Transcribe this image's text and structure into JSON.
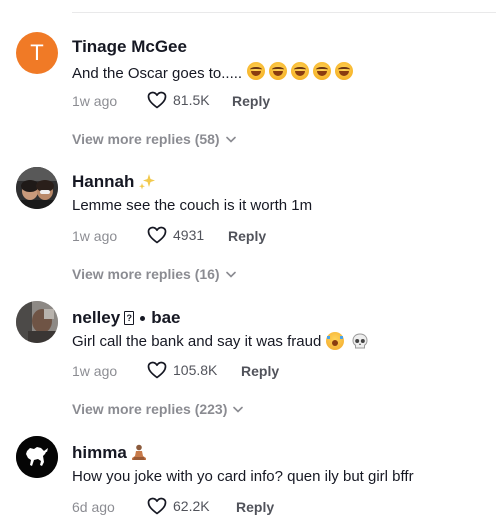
{
  "comments": [
    {
      "username": "Tinage McGee",
      "avatar_letter": "T",
      "text": "And the Oscar goes to.....",
      "time": "1w ago",
      "likes": "81.5K",
      "reply_label": "Reply",
      "more_replies": "View more replies (58)"
    },
    {
      "username": "Hannah",
      "text": "Lemme see the couch is it worth 1m",
      "time": "1w ago",
      "likes": "4931",
      "reply_label": "Reply",
      "more_replies": "View more replies (16)"
    },
    {
      "username_part1": "nelley",
      "username_part2": "bae",
      "text": "Girl call the bank and say it was fraud",
      "time": "1w ago",
      "likes": "105.8K",
      "reply_label": "Reply",
      "more_replies": "View more replies (223)"
    },
    {
      "username": "himma",
      "text": "How you joke with yo card info? quen ily but girl bffr",
      "time": "6d ago",
      "likes": "62.2K",
      "reply_label": "Reply"
    }
  ],
  "icons": {
    "like": "heart-outline-icon",
    "expand": "chevron-down-icon"
  },
  "colors": {
    "avatar_orange": "#f07a26",
    "text_primary": "#161823",
    "text_secondary": "#8a8b91"
  }
}
